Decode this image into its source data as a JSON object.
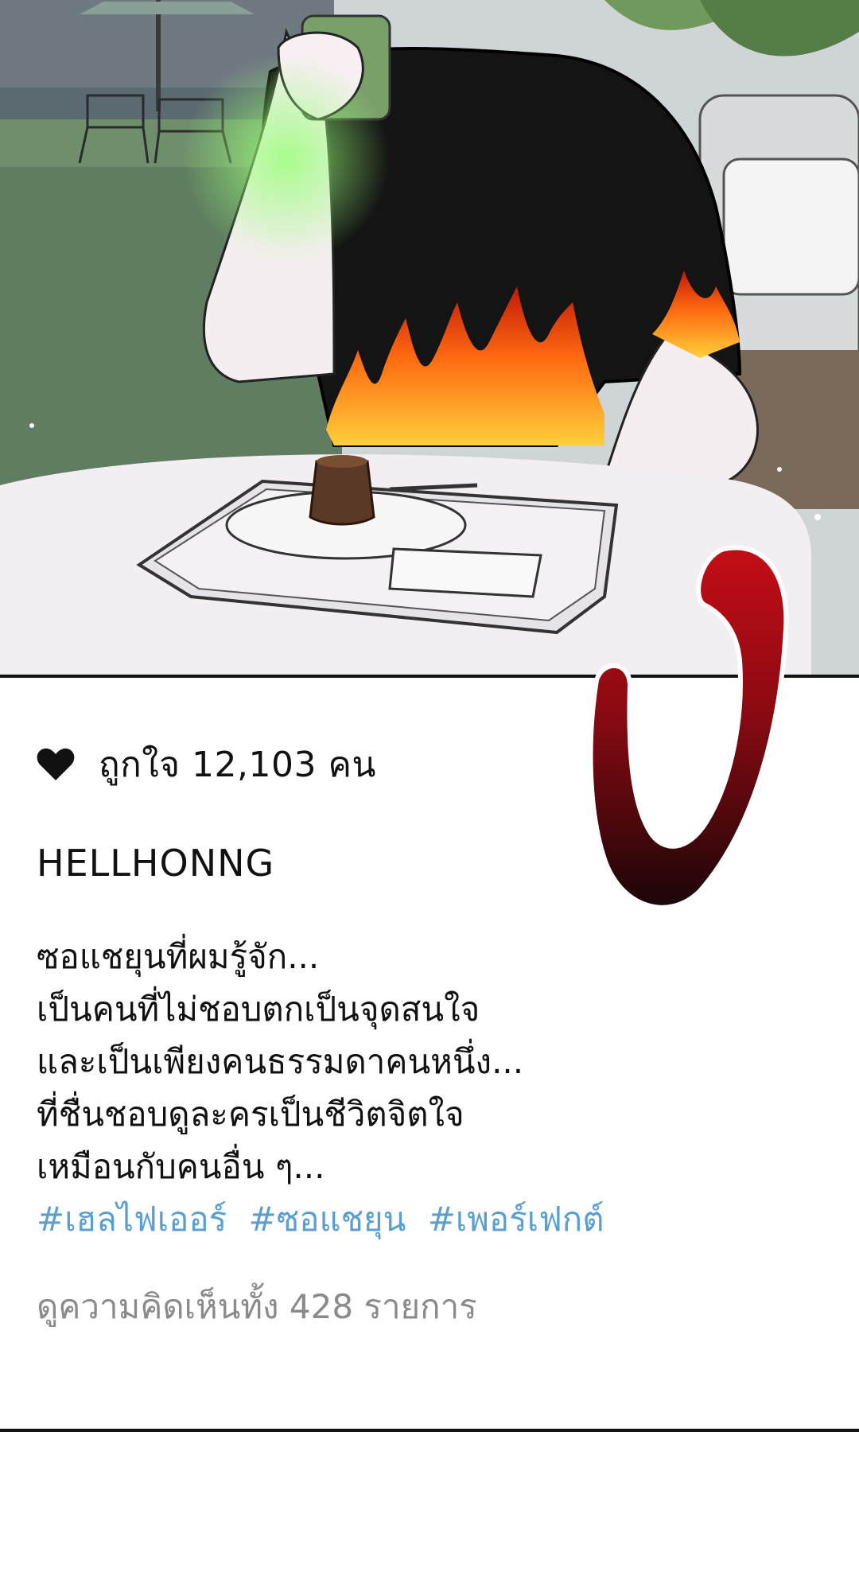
{
  "post": {
    "likes_text": "ถูกใจ 12,103 คน",
    "username": "HELLHONNG",
    "caption_lines": [
      "ซอแชยุนที่ผมรู้จัก...",
      "เป็นคนที่ไม่ชอบตกเป็นจุดสนใจ",
      "และเป็นเพียงคนธรรมดาคนหนึ่ง...",
      "ที่ชื่นชอบดูละครเป็นชีวิตจิตใจ",
      "เหมือนกับคนอื่น ๆ..."
    ],
    "hashtags": [
      "#เฮลไฟเออร์",
      "#ซอแชยุน",
      "#เพอร์เฟกต์"
    ],
    "view_comments": "ดูความคิดเห็นทั้ง 428 รายการ"
  },
  "icons": {
    "like": "heart-icon",
    "overlay_glyph": "red-stylized-letter"
  },
  "colors": {
    "hashtag": "#5a9fd0",
    "muted_text": "#8a8a8a",
    "glyph_red": "#c40d16",
    "glyph_dark": "#1a0608"
  }
}
